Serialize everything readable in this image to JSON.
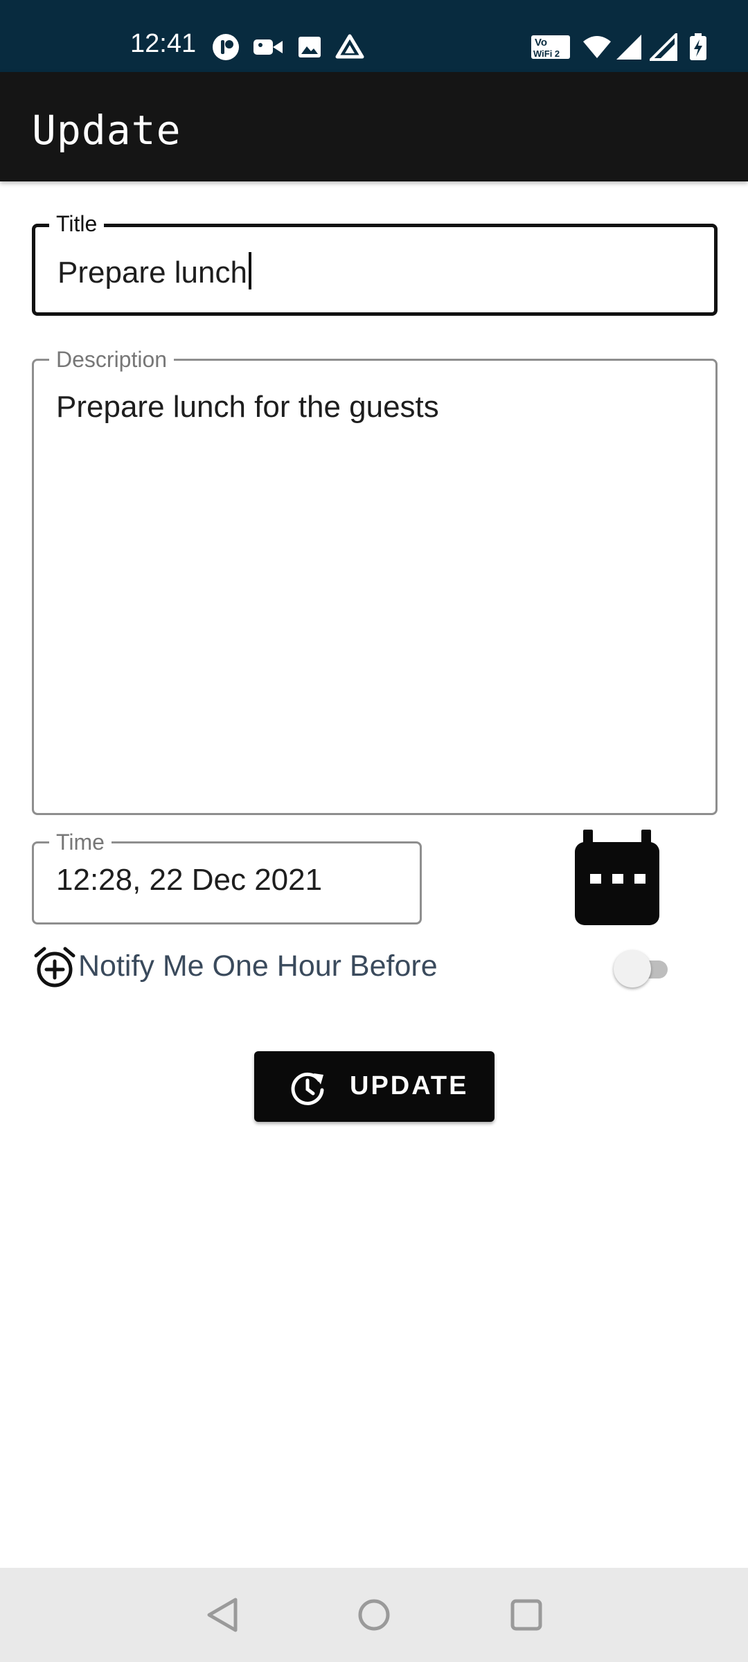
{
  "status_bar": {
    "time": "12:41",
    "left_icons": [
      "notification-app-icon",
      "video-camera-icon",
      "image-icon",
      "drive-icon"
    ],
    "right_icons": [
      "vowifi-icon",
      "wifi-icon",
      "signal-icon",
      "signal-icon-2",
      "battery-charging-icon"
    ],
    "vowifi_text_top": "Vo",
    "vowifi_text_bottom": "WiFi 2"
  },
  "app_bar": {
    "title": "Update"
  },
  "form": {
    "title": {
      "label": "Title",
      "value": "Prepare lunch"
    },
    "description": {
      "label": "Description",
      "value": "Prepare lunch for the guests"
    },
    "time": {
      "label": "Time",
      "value": "12:28, 22 Dec 2021"
    },
    "notify": {
      "label": "Notify Me One Hour Before",
      "enabled": false
    },
    "update_button": {
      "label": "UPDATE"
    }
  },
  "colors": {
    "status_bar": "#082b3f",
    "app_bar": "#151515",
    "button": "#0a0a0a",
    "notify_text": "#3a4a5c",
    "nav_bar": "#e9e9e9"
  }
}
